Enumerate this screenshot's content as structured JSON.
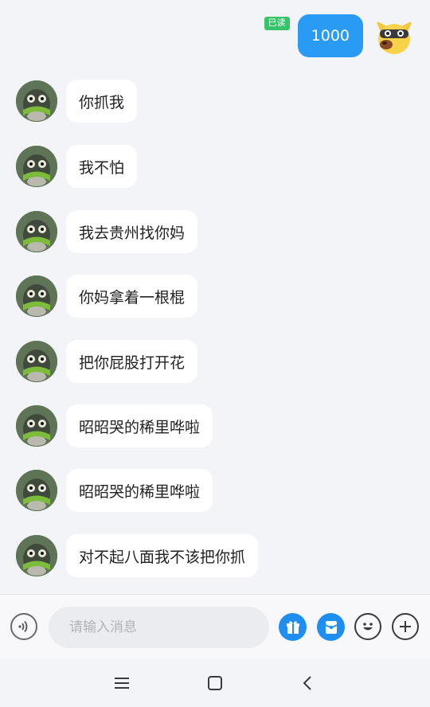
{
  "outgoing": {
    "text": "1000",
    "read_status": "已读"
  },
  "messages": [
    {
      "text": "你抓我"
    },
    {
      "text": "我不怕"
    },
    {
      "text": "我去贵州找你妈"
    },
    {
      "text": "你妈拿着一根棍"
    },
    {
      "text": "把你屁股打开花"
    },
    {
      "text": "昭昭哭的稀里哗啦"
    },
    {
      "text": "昭昭哭的稀里哗啦"
    },
    {
      "text": "对不起八面我不该把你抓"
    }
  ],
  "input": {
    "placeholder": "请输入消息",
    "value": ""
  },
  "colors": {
    "accent": "#2a9bf5",
    "read_badge": "#34c46a",
    "background": "#f3f4f7"
  },
  "icons": {
    "voice": "voice-icon",
    "gift": "gift-icon",
    "red_packet": "red-packet-icon",
    "emoji": "emoji-icon",
    "plus": "plus-icon",
    "nav_menu": "menu-icon",
    "nav_home": "home-icon",
    "nav_back": "back-icon"
  }
}
